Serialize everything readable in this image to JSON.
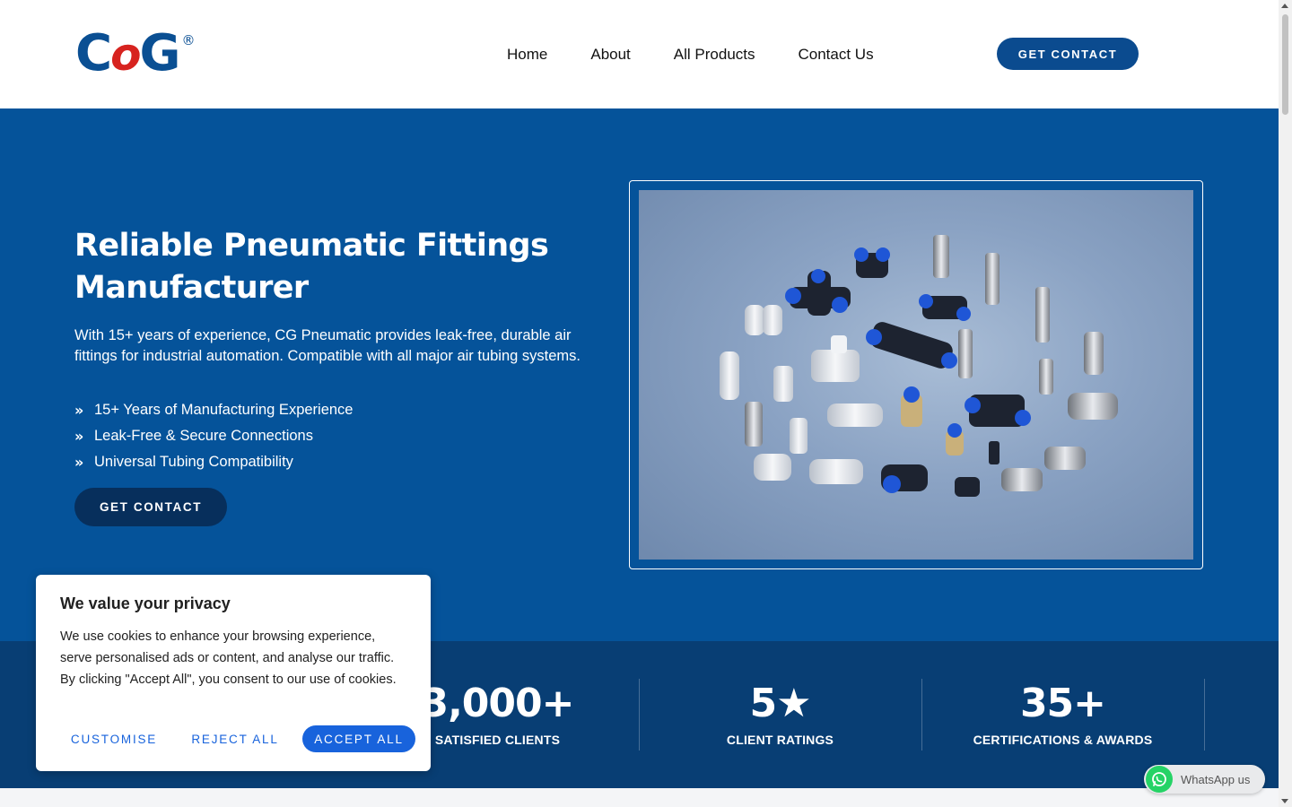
{
  "header": {
    "logo": {
      "c": "C",
      "o": "o",
      "g": "G",
      "reg": "®"
    },
    "nav": [
      "Home",
      "About",
      "All Products",
      "Contact Us"
    ],
    "cta": "GET CONTACT"
  },
  "hero": {
    "title": "Reliable Pneumatic Fittings Manufacturer",
    "description": "With 15+ years of experience, CG Pneumatic provides leak-free, durable air fittings for industrial automation. Compatible with all major air tubing systems.",
    "features": [
      "15+ Years of Manufacturing Experience",
      "Leak-Free & Secure Connections",
      "Universal Tubing Compatibility"
    ],
    "cta": "GET CONTACT"
  },
  "stats": [
    {
      "value": "3,000+",
      "label": "SATISFIED CLIENTS"
    },
    {
      "value": "5★",
      "label": "CLIENT RATINGS"
    },
    {
      "value": "35+",
      "label": "CERTIFICATIONS & AWARDS"
    }
  ],
  "cookie": {
    "title": "We value your privacy",
    "text": "We use cookies to enhance your browsing experience, serve personalised ads or content, and analyse our traffic. By clicking \"Accept All\", you consent to our use of cookies.",
    "customise": "CUSTOMISE",
    "reject": "REJECT ALL",
    "accept": "ACCEPT ALL"
  },
  "whatsapp": {
    "label": "WhatsApp us",
    "icon": "whatsapp-icon"
  },
  "colors": {
    "brand_blue": "#05539a",
    "dark_blue": "#083e74",
    "logo_red": "#d7231f",
    "cookie_accent": "#1863dc",
    "whatsapp_green": "#25d366"
  }
}
